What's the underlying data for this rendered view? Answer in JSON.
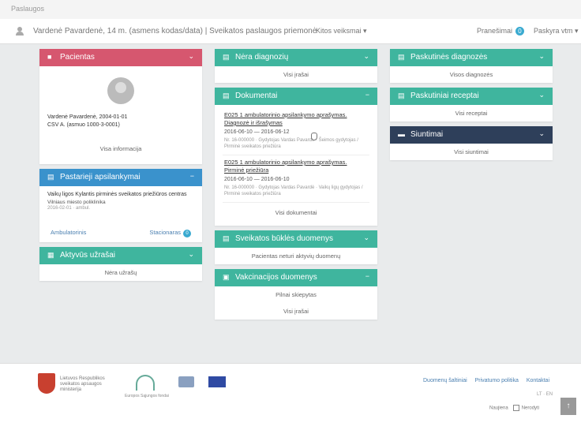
{
  "topbar": {
    "title": "Paslaugos"
  },
  "header": {
    "page_title": "Vardenė Pavardenė, 14 m. (asmens kodas/data) | Sveikatos paslaugos priemonė",
    "dropdown": "Kitos veiksmai ▾",
    "lang": "Pranešimai",
    "badge": "0",
    "context": "Paskyra vtm ▾"
  },
  "col1": {
    "patient": {
      "title": "Pacientas",
      "name_line": "Vardenė Pavardenė, 2004-01-01",
      "code_line": "CSV A. (asmuo 1000-3-0001)",
      "more": "Visa informacija"
    },
    "events": {
      "title": "Pastarieji apsilankymai",
      "item_text": "Vaikų ligos Kylantis pirminės sveikatos priežiūros centras",
      "item_org": "Vilniaus miesto poliklinika",
      "item_date": "2016-02-01 · ambul.",
      "tab1": "Ambulatorinis",
      "tab1_count": "",
      "tab2": "Stacionaras",
      "tab2_count": "0"
    },
    "notes": {
      "title": "Aktyvūs užrašai",
      "empty": "Nėra užrašų"
    }
  },
  "col2": {
    "diagnoses": {
      "title": "Nėra diagnozių",
      "link": "Visi įrašai"
    },
    "documents": {
      "title": "Dokumentai",
      "items": [
        {
          "title": "E025 1 ambulatorinio apsilankymo aprašymas. Diagnozė ir išrašymas",
          "date": "2016-06-10 — 2016-06-12",
          "sub": "Nr. 16-000000 · Gydytojas Vardas Pavardė · Šeimos gydytojas / Pirminė sveikatos priežiūra"
        },
        {
          "title": "E025 1 ambulatorinio apsilankymo aprašymas. Pirminė priežiūra",
          "date": "2016-06-10 — 2016-06-10",
          "sub": "Nr. 16-000000 · Gydytojas Vardas Pavardė · Vaikų ligų gydytojas / Pirminė sveikatos priežiūra"
        }
      ],
      "more": "Visi dokumentai"
    },
    "alerts": {
      "title": "Sveikatos būklės duomenys",
      "text": "Pacientas neturi aktyvių duomenų"
    },
    "vaccines": {
      "title": "Vakcinacijos duomenys",
      "text1": "Pilnai skiepytas",
      "text2": "Visi įrašai"
    }
  },
  "col3": {
    "diag": {
      "title": "Paskutinės diagnozės",
      "link": "Visos diagnozės"
    },
    "recipes": {
      "title": "Paskutiniai receptai",
      "link": "Visi receptai"
    },
    "referrals": {
      "title": "Siuntimai",
      "link": "Visi siuntimai"
    }
  },
  "footer": {
    "logo_text": "Lietuvos Respublikos sveikatos apsaugos ministerija",
    "logo2_text": "Europos Sąjungos fondai",
    "links": [
      "Duomenų šaltiniai",
      "Privatumo politika",
      "Kontaktai"
    ],
    "small": "LT · EN",
    "status_label": "Naujiena",
    "status_value": "Nerodyti"
  },
  "colors": {
    "teal": "#3fb59e",
    "pink": "#d6576f",
    "blue": "#3a92cc",
    "navy": "#2e3f5a"
  }
}
